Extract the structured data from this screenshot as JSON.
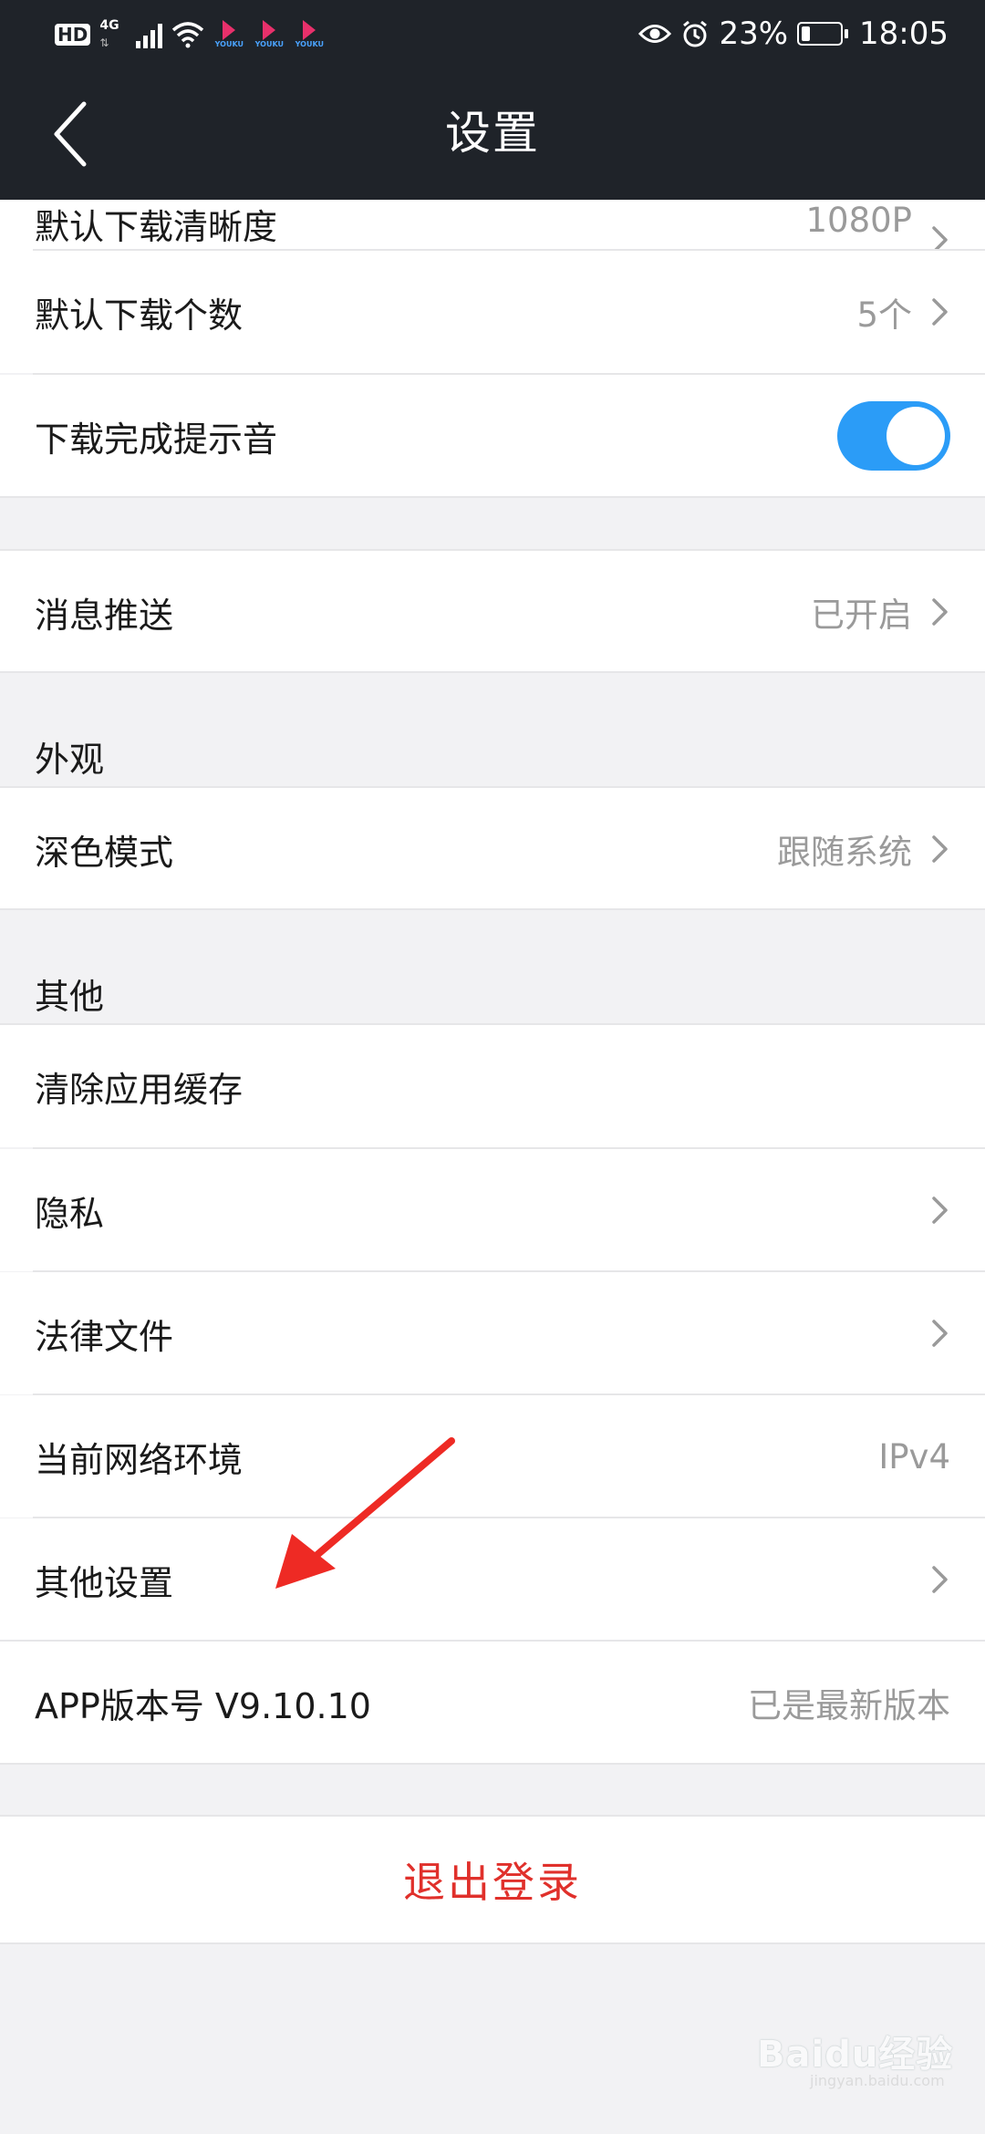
{
  "status_bar": {
    "hd": "HD",
    "network": "4G",
    "app_logo_label": "YOUKU",
    "battery": "23%",
    "battery_level": 0.23,
    "time": "18:05"
  },
  "header": {
    "title": "设置",
    "back_icon": "chevron-left-icon"
  },
  "rows": {
    "default_quality": {
      "label": "默认下载清晰度",
      "value": "1080P"
    },
    "default_count": {
      "label": "默认下载个数",
      "value": "5个"
    },
    "download_sound": {
      "label": "下载完成提示音",
      "toggle_on": true
    },
    "push": {
      "label": "消息推送",
      "value": "已开启"
    },
    "dark_mode": {
      "label": "深色模式",
      "value": "跟随系统"
    },
    "clear_cache": {
      "label": "清除应用缓存"
    },
    "privacy": {
      "label": "隐私"
    },
    "legal": {
      "label": "法律文件"
    },
    "network_env": {
      "label": "当前网络环境",
      "value": "IPv4"
    },
    "other_settings": {
      "label": "其他设置"
    },
    "app_version": {
      "label": "APP版本号 V9.10.10",
      "value": "已是最新版本"
    }
  },
  "sections": {
    "appearance": "外观",
    "other": "其他"
  },
  "logout": {
    "label": "退出登录"
  },
  "watermark": {
    "brand": "Baidu经验",
    "sub": "jingyan.baidu.com"
  },
  "colors": {
    "header_bg": "#1f2329",
    "toggle_on": "#2b9cf7",
    "logout_red": "#e0302b",
    "annotation_arrow": "#ee2a24"
  }
}
